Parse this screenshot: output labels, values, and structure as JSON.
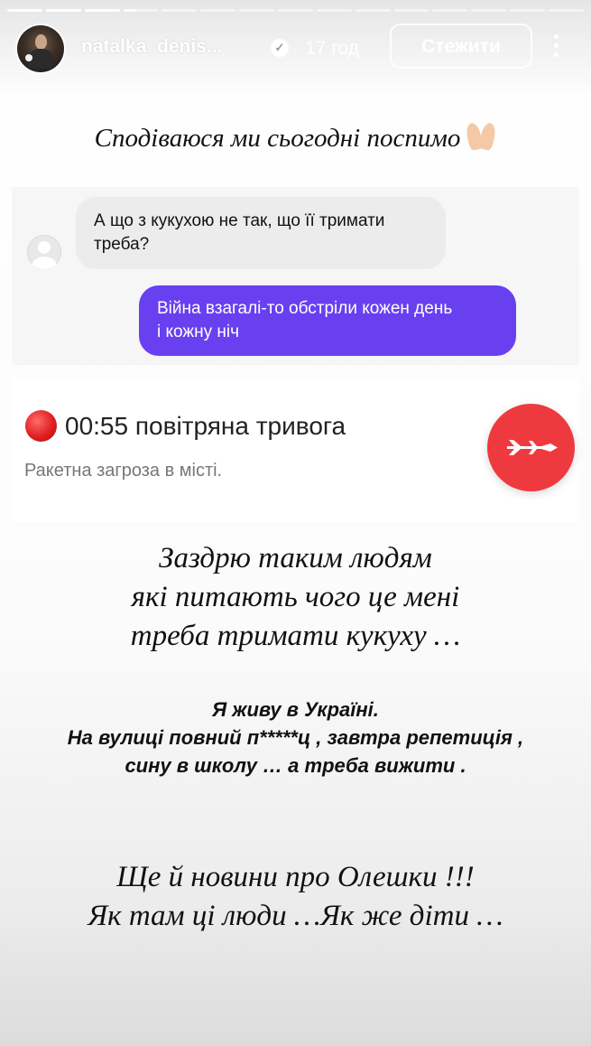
{
  "header": {
    "username": "natalka_denis...",
    "time": "17 год",
    "follow_label": "Стежити",
    "progress": {
      "segments": 15,
      "completed": 3,
      "active_fraction": 0.35
    }
  },
  "captions": {
    "top": "Сподіваюся ми сьогодні поспимо",
    "envy_lines": [
      "Заздрю таким людям",
      "які питають чого це мені",
      "треба тримати кукуху …"
    ],
    "ukraine_lines": [
      "Я живу в Україні.",
      "На вулиці повний п*****ц , завтра репетиція ,",
      "сину в школу … а треба вижити ."
    ],
    "news_lines": [
      "Ще й новини про Олешки !!!",
      "Як там ці люди …Як же діти …"
    ]
  },
  "chat": {
    "incoming_lines": [
      "А що з кукухою не так, що її тримати",
      "треба?"
    ],
    "outgoing_lines": [
      "Війна взагалі-то обстріли кожен день",
      "і кожну ніч"
    ]
  },
  "alert": {
    "title": "00:55 повітряна тривога",
    "subtitle": "Ракетна загроза в місті."
  },
  "icons": {
    "verified": "verified-badge-icon",
    "more": "more-vertical-icon",
    "pray": "praying-hands-icon",
    "alert_dot": "red-circle-icon",
    "missile": "missile-icon"
  },
  "colors": {
    "outgoing_bubble": "#6840f0",
    "incoming_bubble": "#ececec",
    "alert_button": "#ee3a3f"
  }
}
